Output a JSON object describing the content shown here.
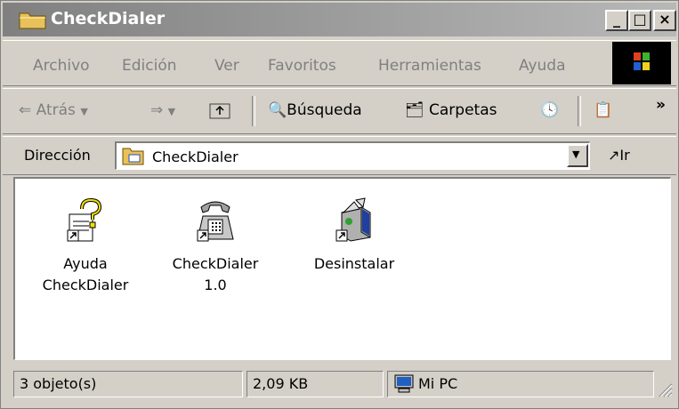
{
  "window": {
    "title": "CheckDialer"
  },
  "title_buttons": {
    "minimize": "_",
    "maximize": "□",
    "close": "×"
  },
  "menu": [
    "Archivo",
    "Edición",
    "Ver",
    "Favoritos",
    "Herramientas",
    "Ayuda"
  ],
  "toolbar": {
    "back": "Atrás",
    "search": "Búsqueda",
    "folders": "Carpetas",
    "more": "»"
  },
  "address": {
    "label": "Dirección",
    "value": "CheckDialer",
    "go": "Ir"
  },
  "items": [
    {
      "line1": "Ayuda",
      "line2": "CheckDialer"
    },
    {
      "line1": "CheckDialer",
      "line2": "1.0"
    },
    {
      "line1": "Desinstalar",
      "line2": ""
    }
  ],
  "status": {
    "objects": "3 objeto(s)",
    "size": "2,09 KB",
    "location": "Mi PC"
  },
  "colors": {
    "title_gradient_start": "#808080",
    "title_gradient_end": "#b8b8b8",
    "chrome": "#d4d0c8"
  }
}
